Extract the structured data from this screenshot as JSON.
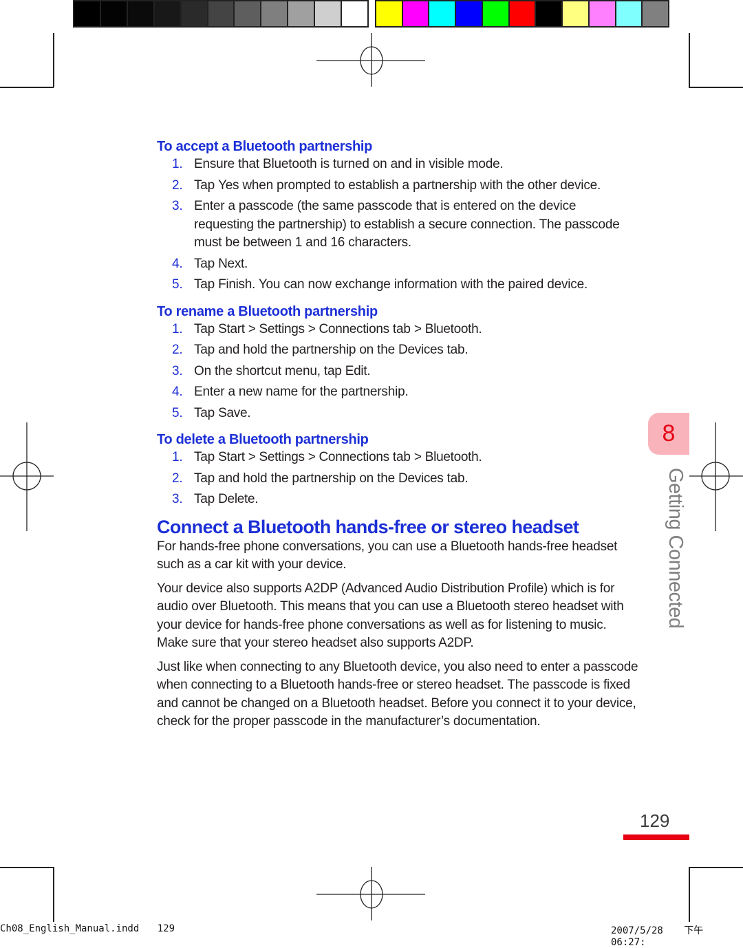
{
  "color_bars": {
    "grayscale": [
      "#000000",
      "#030303",
      "#0b0b0b",
      "#181818",
      "#2a2a2a",
      "#444444",
      "#5e5e5e",
      "#7f7f7f",
      "#a0a0a0",
      "#cfcfcf",
      "#ffffff"
    ],
    "process": [
      "#ffff00",
      "#ff00ff",
      "#00ffff",
      "#0000ff",
      "#00ff00",
      "#ff0000",
      "#000000",
      "#ffff80",
      "#ff80ff",
      "#80ffff",
      "#808080"
    ]
  },
  "accept": {
    "heading": "To accept a Bluetooth partnership",
    "steps": [
      {
        "num": "1.",
        "text": "Ensure that Bluetooth is turned on and in visible mode."
      },
      {
        "num": "2.",
        "pre": "Tap ",
        "ui": "Yes",
        "post": " when prompted to establish a partnership with the other device."
      },
      {
        "num": "3.",
        "text": "Enter a passcode (the same passcode that is entered on the device requesting the partnership) to establish a secure connection. The passcode must be between 1 and 16 characters."
      },
      {
        "num": "4.",
        "pre": "Tap ",
        "ui": "Next",
        "post": "."
      },
      {
        "num": "5.",
        "pre": "Tap ",
        "ui": "Finish",
        "post": ". You can now exchange information with the paired device."
      }
    ]
  },
  "rename": {
    "heading": "To rename a Bluetooth partnership",
    "steps": [
      {
        "num": "1.",
        "pre": "Tap ",
        "ui": "Start > Settings > Connections",
        "post": " tab > ",
        "ui2": "Bluetooth",
        "post2": "."
      },
      {
        "num": "2.",
        "pre": "Tap and hold the partnership on the ",
        "ui": "Devices",
        "post": " tab."
      },
      {
        "num": "3.",
        "pre": "On the shortcut menu, tap ",
        "ui": "Edit",
        "post": "."
      },
      {
        "num": "4.",
        "text": "Enter a new name for the partnership."
      },
      {
        "num": "5.",
        "pre": "Tap ",
        "ui": "Save",
        "post": "."
      }
    ]
  },
  "delete": {
    "heading": "To delete a Bluetooth partnership",
    "steps": [
      {
        "num": "1.",
        "pre": "Tap ",
        "ui": "Start > Settings > Connections",
        "post": " tab > ",
        "ui2": "Bluetooth",
        "post2": "."
      },
      {
        "num": "2.",
        "pre": "Tap and hold the partnership on the ",
        "ui": "Devices",
        "post": " tab."
      },
      {
        "num": "3.",
        "pre": "Tap ",
        "ui": "Delete",
        "post": "."
      }
    ]
  },
  "headset": {
    "heading": "Connect a Bluetooth hands-free or stereo headset",
    "paragraphs": [
      "For hands-free phone conversations, you can use a Bluetooth hands-free headset such as a car kit with your device.",
      "Your device also supports A2DP (Advanced Audio Distribution Profile) which is for audio over Bluetooth. This means that you can use a Bluetooth stereo headset with your device for hands-free phone conversations as well as for listening to music. Make sure that your stereo headset also supports A2DP.",
      "Just like when connecting to any Bluetooth device, you also need to enter a passcode when connecting to a Bluetooth hands-free or stereo headset. The passcode is fixed and cannot be changed on a Bluetooth headset. Before you connect it to your device, check for the proper passcode in the manufacturer’s documentation."
    ]
  },
  "chapter": {
    "number": "8",
    "title": "Getting Connected"
  },
  "page_number": "129",
  "slug": {
    "file": "Ch08_English_Manual.indd",
    "page": "129",
    "date": "2007/5/28",
    "time": "下午 06:27:"
  }
}
